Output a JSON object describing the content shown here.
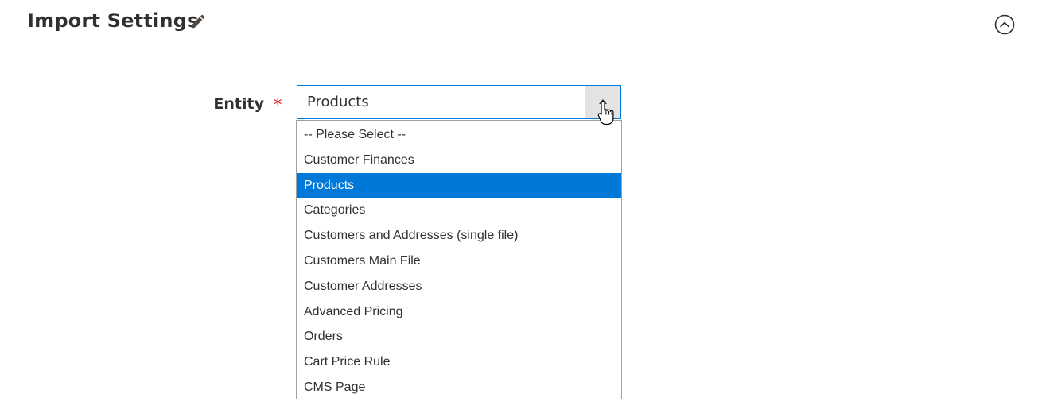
{
  "section": {
    "title": "Import Settings"
  },
  "form": {
    "entity": {
      "label": "Entity",
      "required_mark": "*",
      "value": "Products",
      "options": [
        "-- Please Select --",
        "Customer Finances",
        "Products",
        "Categories",
        "Customers and Addresses (single file)",
        "Customers Main File",
        "Customer Addresses",
        "Advanced Pricing",
        "Orders",
        "Cart Price Rule",
        "CMS Page"
      ],
      "selected_index": 2
    }
  },
  "icons": {
    "edit": "pencil-icon",
    "collapse": "chevron-up-circle-icon",
    "toggle": "caret-up-icon",
    "cursor": "hand-pointer-cursor-icon"
  },
  "colors": {
    "selected_bg": "#0078d7",
    "focus_border": "#007bdb",
    "required": "#e22626",
    "text": "#303030"
  }
}
